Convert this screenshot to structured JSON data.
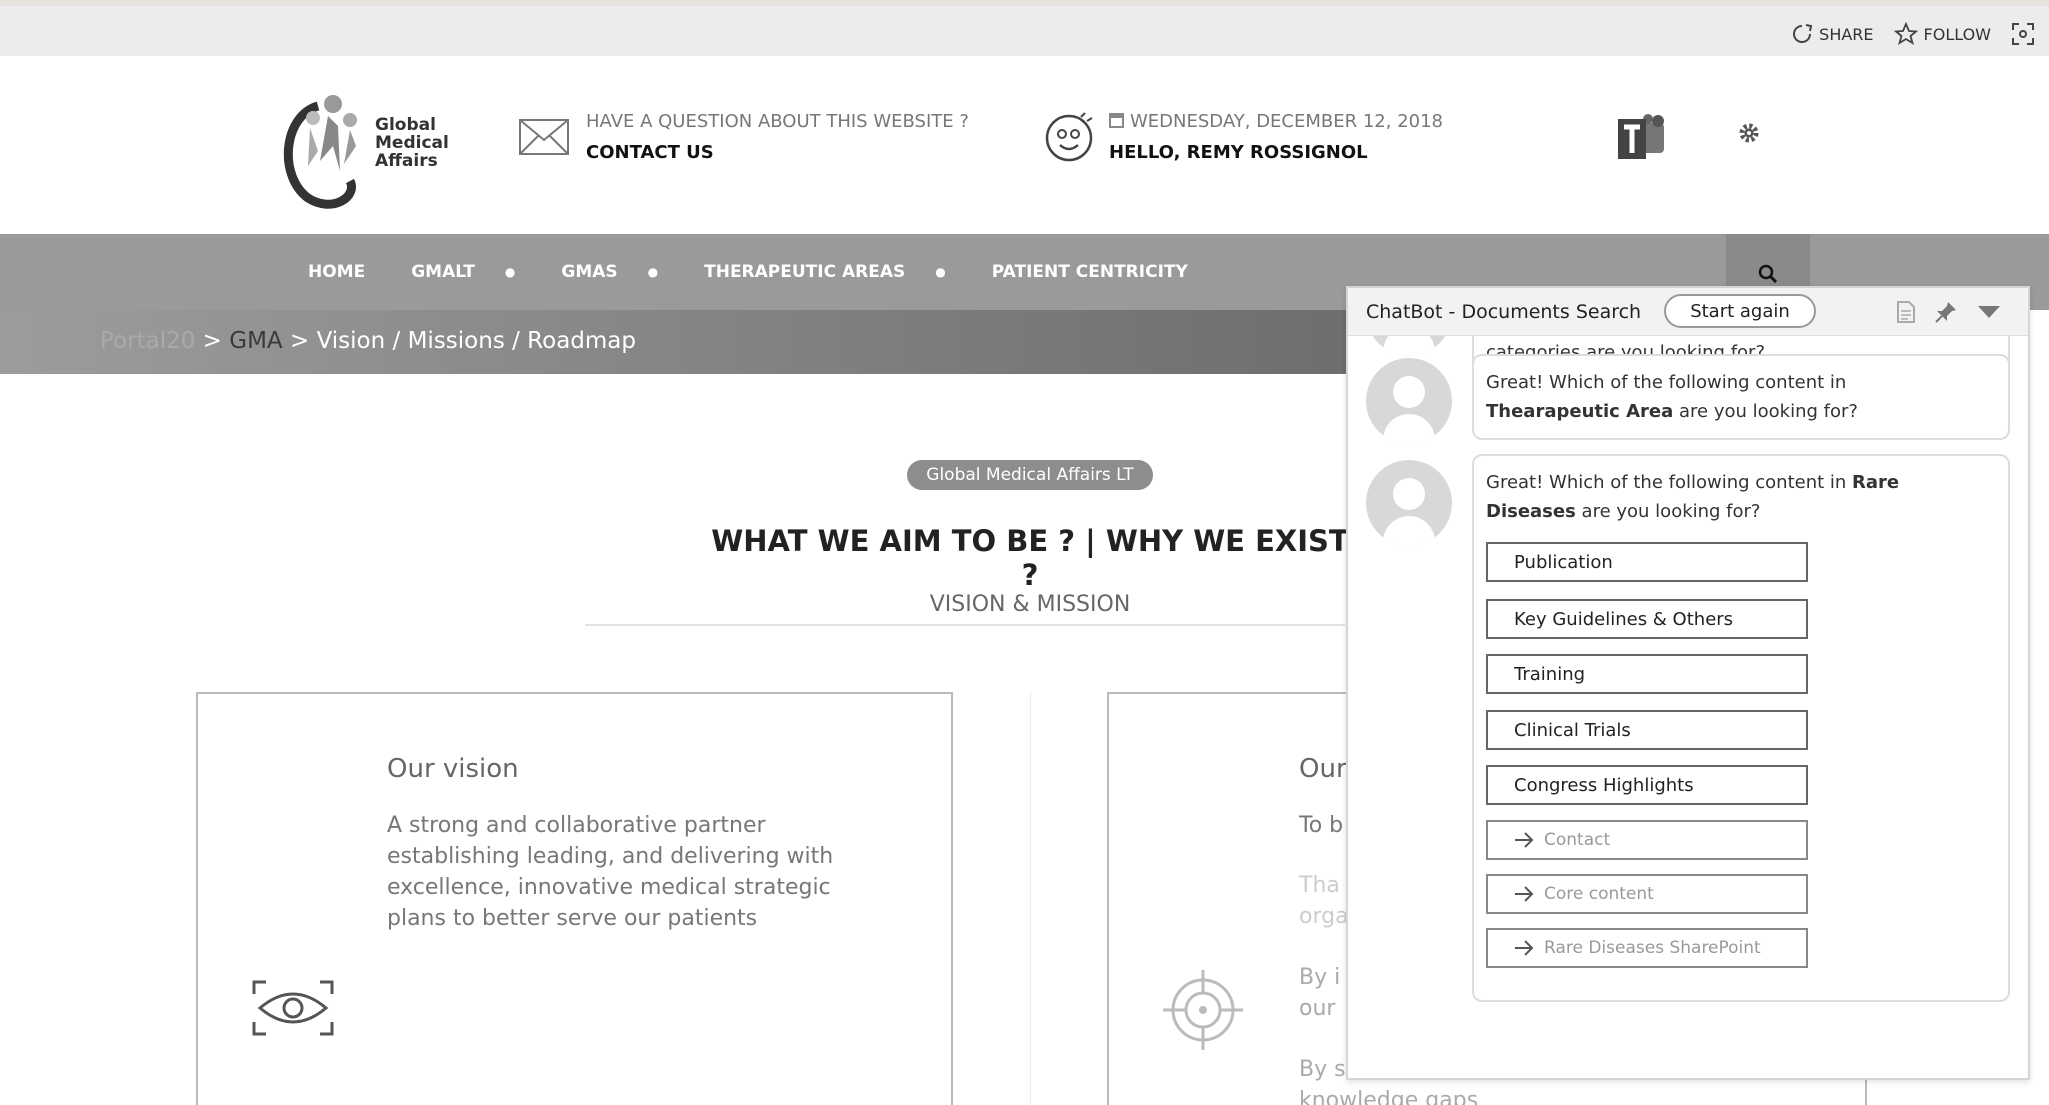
{
  "top_actions": {
    "share": "SHARE",
    "follow": "FOLLOW"
  },
  "logo": {
    "line1": "Global",
    "line2": "Medical",
    "line3": "Affairs"
  },
  "contact": {
    "question": "HAVE A QUESTION ABOUT THIS WEBSITE ?",
    "link": "CONTACT US"
  },
  "date_block": {
    "date": "WEDNESDAY, DECEMBER 12, 2018",
    "greeting": "HELLO, REMY ROSSIGNOL"
  },
  "nav": [
    {
      "label": "HOME",
      "has_dropdown": false
    },
    {
      "label": "GMALT",
      "has_dropdown": true
    },
    {
      "label": "GMAS",
      "has_dropdown": true
    },
    {
      "label": "THERAPEUTIC AREAS",
      "has_dropdown": true
    },
    {
      "label": "PATIENT CENTRICITY",
      "has_dropdown": false
    }
  ],
  "breadcrumb": {
    "root": "Portal20",
    "sep1": " > ",
    "gma": "GMA",
    "rest": " > Vision / Missions / Roadmap"
  },
  "main": {
    "pill": "Global Medical Affairs LT",
    "title": "WHAT WE AIM TO BE ? | WHY WE EXIST ?",
    "subtitle": "VISION & MISSION"
  },
  "vision_card": {
    "title": "Our vision",
    "lines": [
      "A strong and collaborative partner",
      "establishing leading, and delivering with",
      "excellence, innovative medical strategic",
      "plans to better serve our patients"
    ]
  },
  "mission_card": {
    "title": "Our",
    "p1": "To b",
    "p2a": "Tha",
    "p2b": "orga",
    "p3a": "By i",
    "p3b": "our",
    "p4a": "By s",
    "p4b": "knowledge gaps"
  },
  "chatbot": {
    "title": "ChatBot - Documents Search",
    "start_again": "Start again",
    "msg0": "categories are you looking for?",
    "msg1_pre": "Great! Which of the following content in",
    "msg1_bold": "Thearapeutic Area",
    "msg1_post": " are you looking for?",
    "msg2_pre": "Great! Which of the following content in ",
    "msg2_bold1": "Rare",
    "msg2_bold2": "Diseases",
    "msg2_post": " are you looking for?",
    "options": [
      "Publication",
      "Key Guidelines & Others",
      "Training",
      "Clinical Trials",
      "Congress Highlights"
    ],
    "links": [
      "Contact",
      "Core content",
      "Rare Diseases SharePoint"
    ]
  }
}
